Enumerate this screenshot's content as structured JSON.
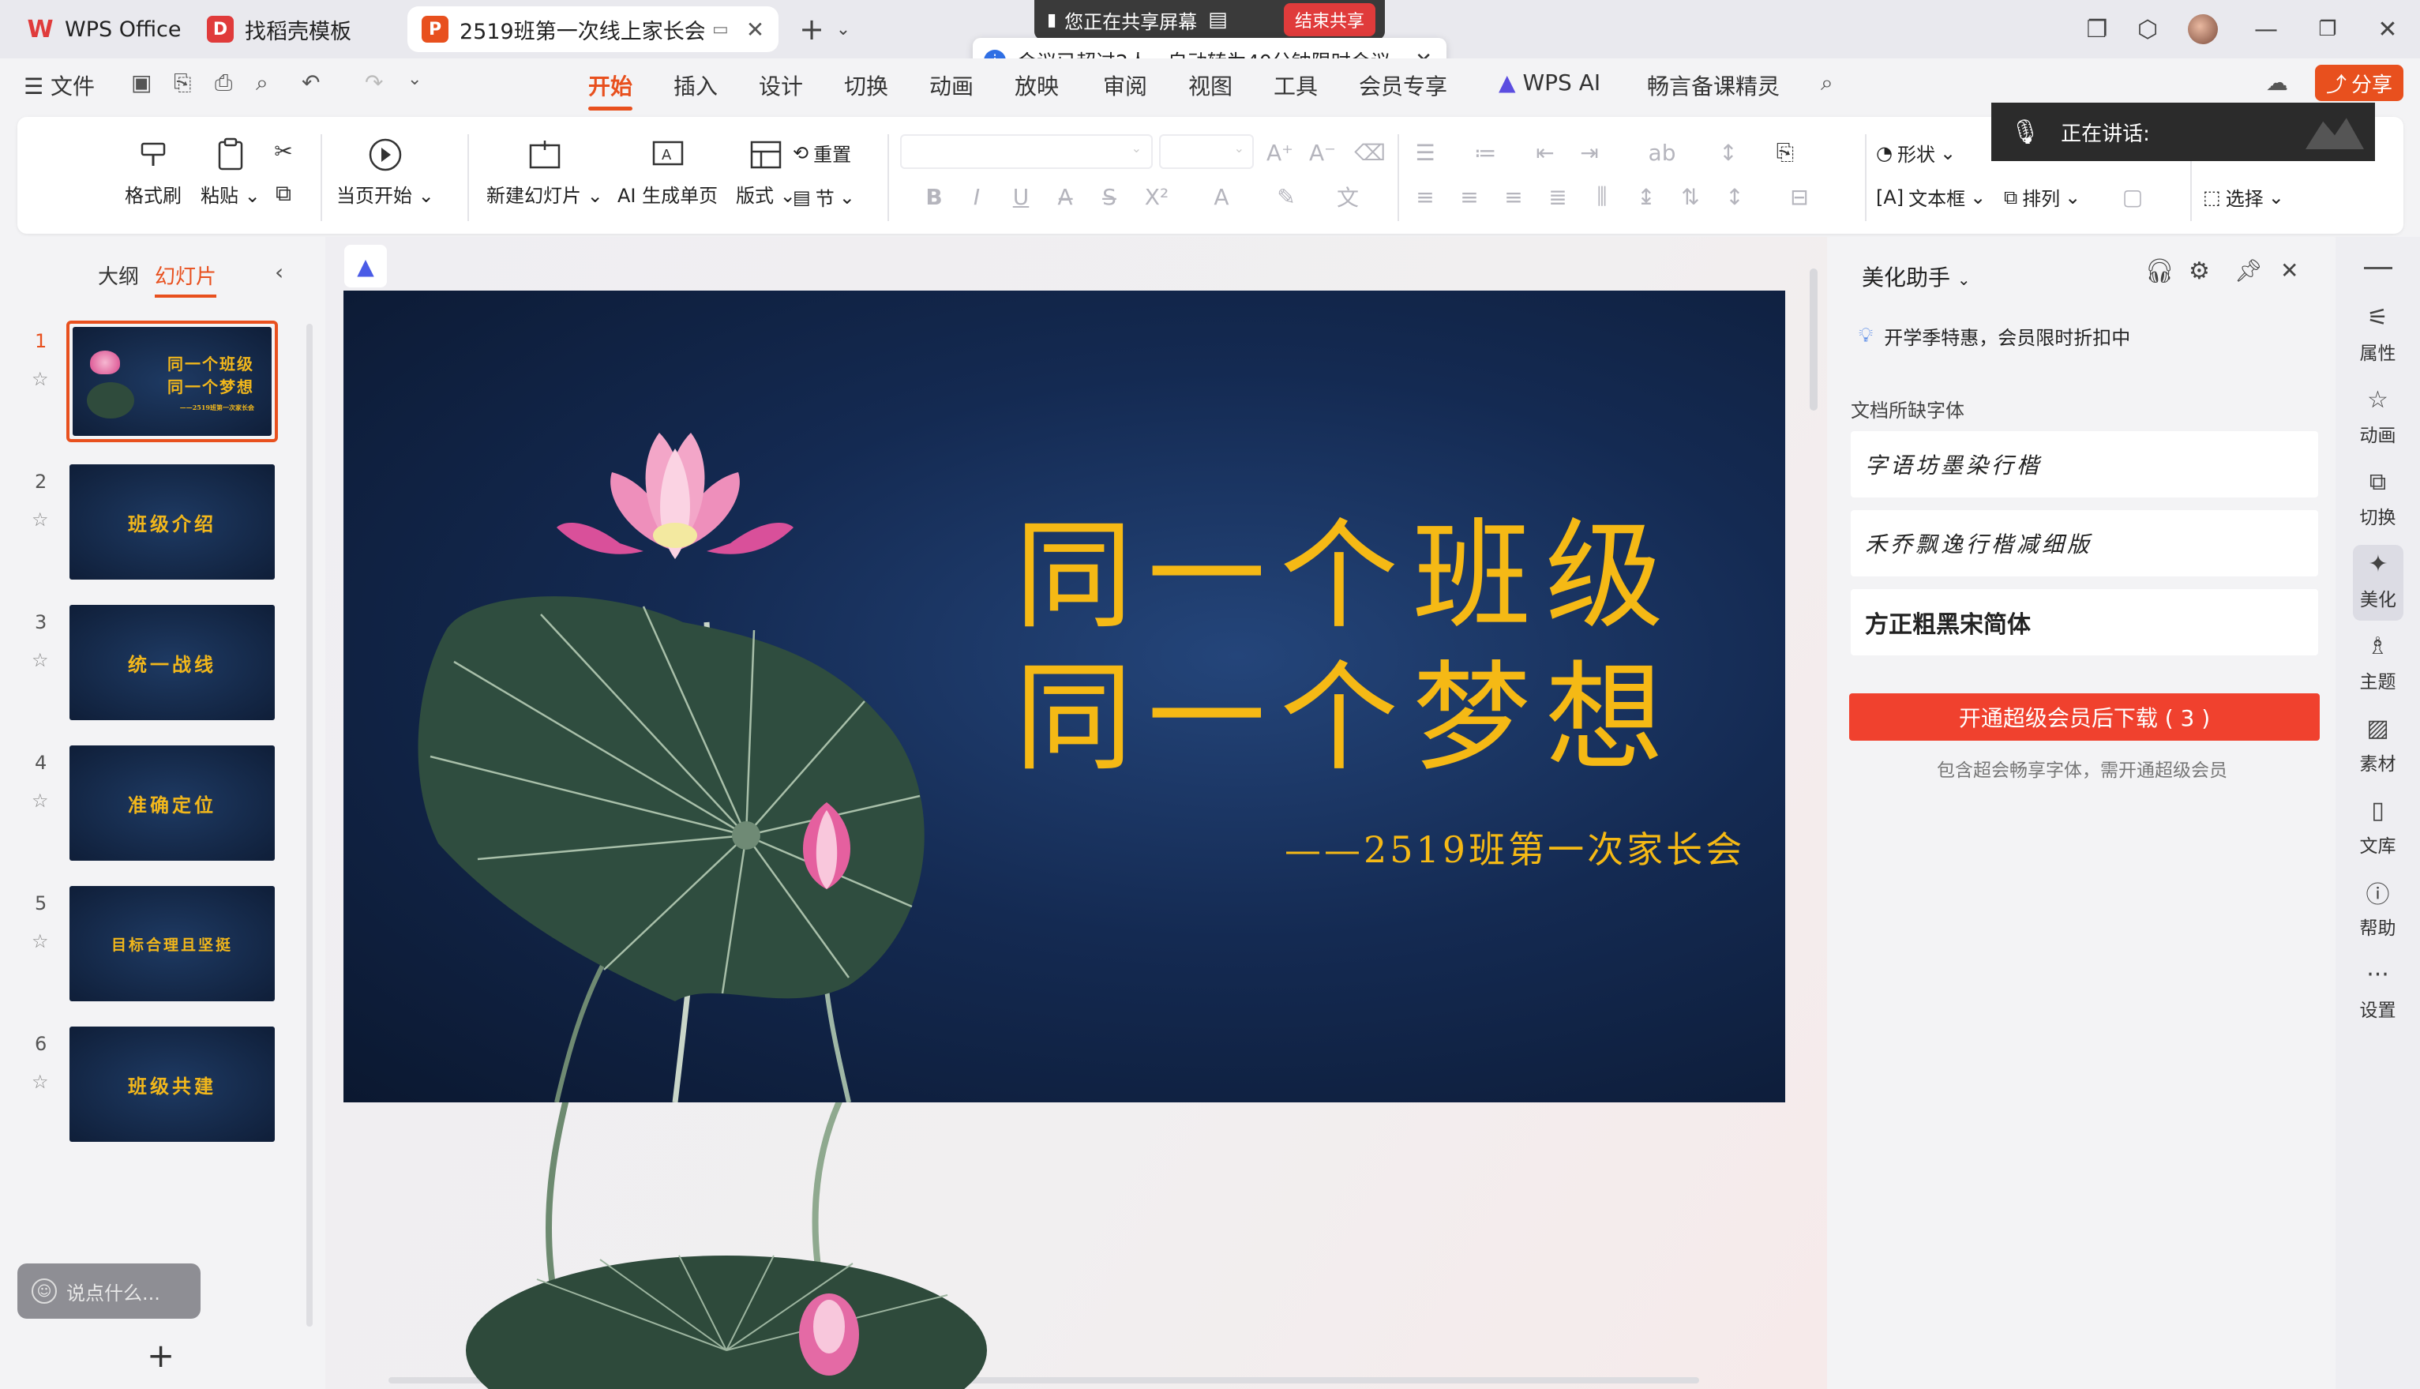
{
  "titlebar": {
    "tabs": [
      {
        "label": "WPS Office"
      },
      {
        "label": "找稻壳模板"
      },
      {
        "label": "2519班第一次线上家长会.ppt"
      }
    ]
  },
  "share": {
    "status": "您正在共享屏幕",
    "end_label": "结束共享",
    "notice": "会议已超过2人，自动转为40分钟限时会议。"
  },
  "menu": {
    "file": "文件",
    "tabs": [
      "开始",
      "插入",
      "设计",
      "切换",
      "动画",
      "放映",
      "审阅",
      "视图",
      "工具",
      "会员专享",
      "WPS AI",
      "畅言备课精灵"
    ],
    "share_button": "分享"
  },
  "ribbon": {
    "format_painter": "格式刷",
    "paste": "粘贴",
    "play_from_current": "当页开始",
    "new_slide": "新建幻灯片",
    "ai_generate": "AI 生成单页",
    "layout": "版式",
    "reset": "重置",
    "section": "节",
    "shape": "形状",
    "textbox": "文本框",
    "arrange": "排列",
    "select": "选择"
  },
  "speaking": {
    "label": "正在讲话:"
  },
  "left_panel": {
    "tab_outline": "大纲",
    "tab_slides": "幻灯片",
    "chat_placeholder": "说点什么...",
    "slides": [
      {
        "num": "1",
        "title": "同一个班级\n同一个梦想"
      },
      {
        "num": "2",
        "title": "班级介绍"
      },
      {
        "num": "3",
        "title": "统一战线"
      },
      {
        "num": "4",
        "title": "准确定位"
      },
      {
        "num": "5",
        "title": "目标合理且坚挺"
      },
      {
        "num": "6",
        "title": "班级共建"
      }
    ]
  },
  "slide": {
    "title_line1": "同一个班级",
    "title_line2": "同一个梦想",
    "subtitle": "——2519班第一次家长会",
    "thumb_sub": "——2519班第一次家长会"
  },
  "right_panel": {
    "title": "美化助手",
    "promo": "开学季特惠，会员限时折扣中",
    "missing_fonts_label": "文档所缺字体",
    "fonts": [
      "字语坊墨染行楷",
      "禾乔飘逸行楷减细版",
      "方正粗黑宋简体"
    ],
    "download_button": "开通超级会员后下载 ( 3 )",
    "hint": "包含超会畅享字体，需开通超级会员"
  },
  "sidebar": {
    "items": [
      "属性",
      "动画",
      "切换",
      "美化",
      "主题",
      "素材",
      "文库",
      "帮助",
      "设置"
    ]
  },
  "colors": {
    "accent": "#e8501e",
    "slide_gold": "#f5b915",
    "vip_red": "#f0412e"
  }
}
